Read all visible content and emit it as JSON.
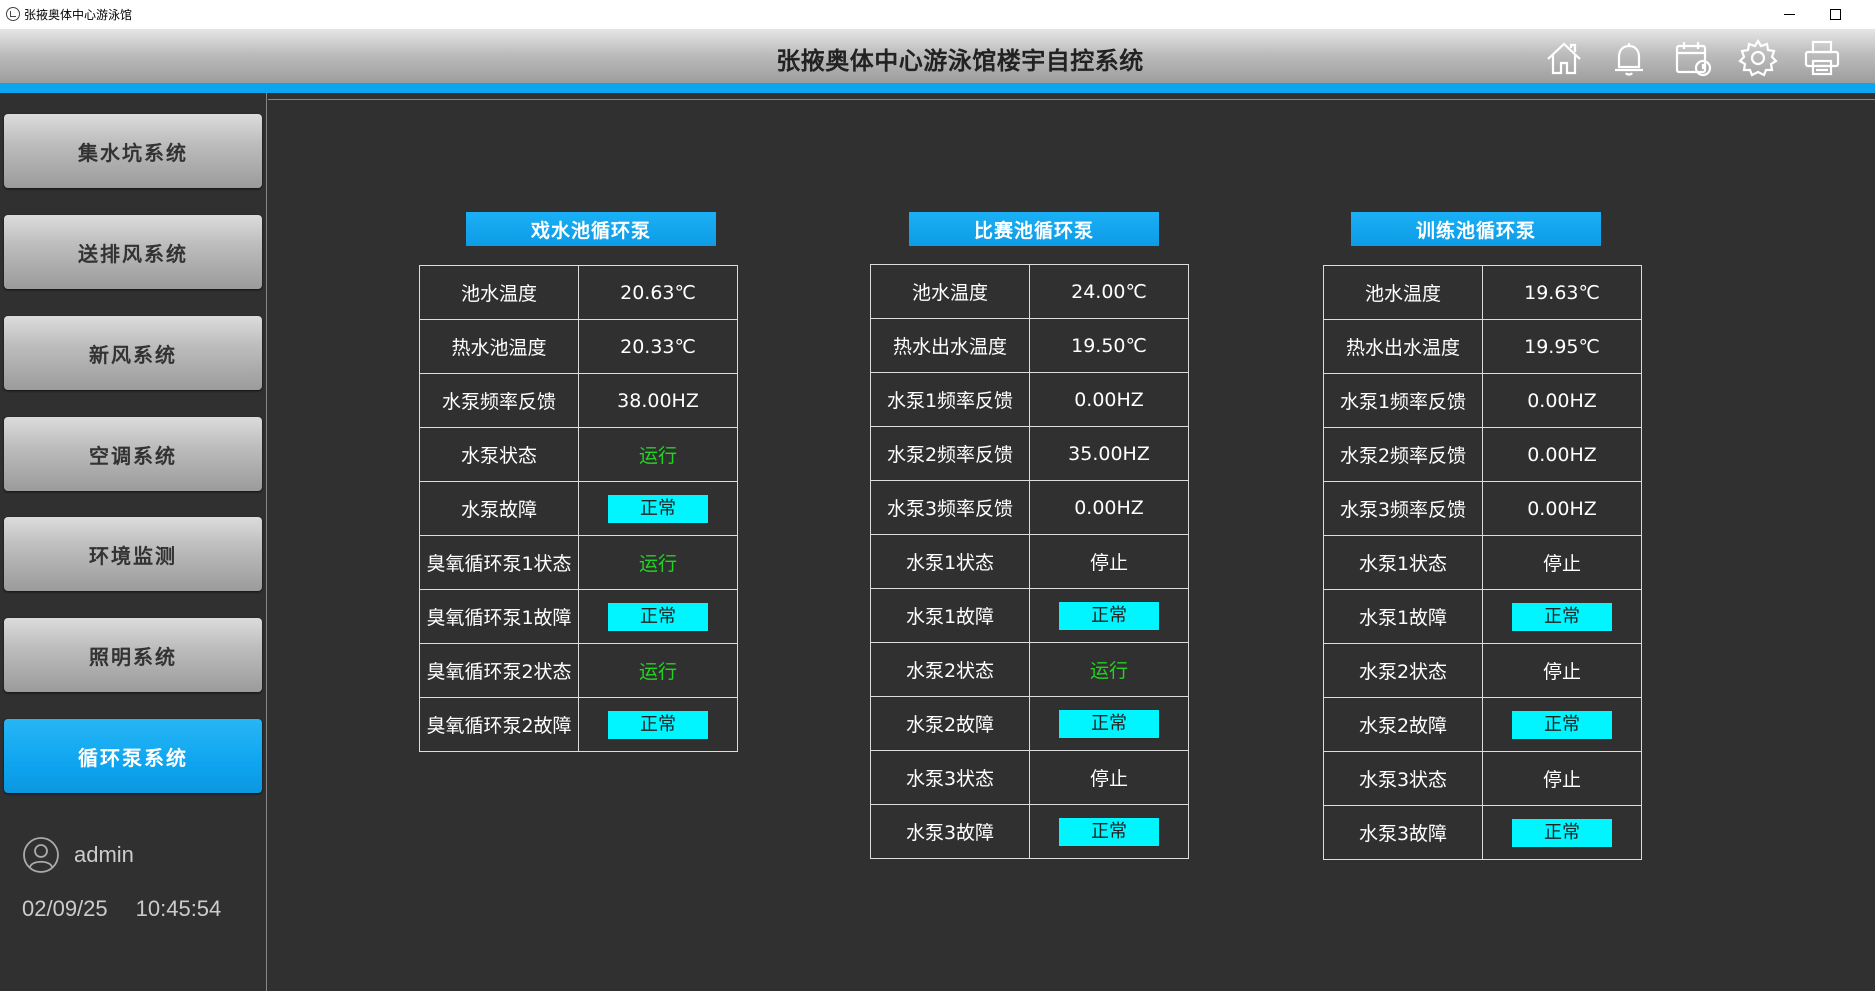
{
  "window": {
    "title": "张掖奥体中心游泳馆"
  },
  "header": {
    "title": "张掖奥体中心游泳馆楼宇自控系统",
    "icons": [
      "home-icon",
      "bell-icon",
      "calendar-icon",
      "gear-icon",
      "printer-icon"
    ]
  },
  "sidebar": {
    "items": [
      {
        "label": "集水坑系统",
        "active": false
      },
      {
        "label": "送排风系统",
        "active": false
      },
      {
        "label": "新风系统",
        "active": false
      },
      {
        "label": "空调系统",
        "active": false
      },
      {
        "label": "环境监测",
        "active": false
      },
      {
        "label": "照明系统",
        "active": false
      },
      {
        "label": "循环泵系统",
        "active": true
      }
    ],
    "user": "admin",
    "date": "02/09/25",
    "time": "10:45:54"
  },
  "colors": {
    "accent": "#0ea5f0",
    "ok_badge": "#00f5ff",
    "running": "#22d322"
  },
  "panels": [
    {
      "title": "戏水池循环泵",
      "rows": [
        {
          "label": "池水温度",
          "value": "20.63℃",
          "kind": "text"
        },
        {
          "label": "热水池温度",
          "value": "20.33℃",
          "kind": "text"
        },
        {
          "label": "水泵频率反馈",
          "value": "38.00HZ",
          "kind": "text"
        },
        {
          "label": "水泵状态",
          "value": "运行",
          "kind": "run"
        },
        {
          "label": "水泵故障",
          "value": "正常",
          "kind": "ok"
        },
        {
          "label": "臭氧循环泵1状态",
          "value": "运行",
          "kind": "run"
        },
        {
          "label": "臭氧循环泵1故障",
          "value": "正常",
          "kind": "ok"
        },
        {
          "label": "臭氧循环泵2状态",
          "value": "运行",
          "kind": "run"
        },
        {
          "label": "臭氧循环泵2故障",
          "value": "正常",
          "kind": "ok"
        }
      ]
    },
    {
      "title": "比赛池循环泵",
      "rows": [
        {
          "label": "池水温度",
          "value": "24.00℃",
          "kind": "text"
        },
        {
          "label": "热水出水温度",
          "value": "19.50℃",
          "kind": "text"
        },
        {
          "label": "水泵1频率反馈",
          "value": "0.00HZ",
          "kind": "text"
        },
        {
          "label": "水泵2频率反馈",
          "value": "35.00HZ",
          "kind": "text"
        },
        {
          "label": "水泵3频率反馈",
          "value": "0.00HZ",
          "kind": "text"
        },
        {
          "label": "水泵1状态",
          "value": "停止",
          "kind": "stop"
        },
        {
          "label": "水泵1故障",
          "value": "正常",
          "kind": "ok"
        },
        {
          "label": "水泵2状态",
          "value": "运行",
          "kind": "run"
        },
        {
          "label": "水泵2故障",
          "value": "正常",
          "kind": "ok"
        },
        {
          "label": "水泵3状态",
          "value": "停止",
          "kind": "stop"
        },
        {
          "label": "水泵3故障",
          "value": "正常",
          "kind": "ok"
        }
      ]
    },
    {
      "title": "训练池循环泵",
      "rows": [
        {
          "label": "池水温度",
          "value": "19.63℃",
          "kind": "text"
        },
        {
          "label": "热水出水温度",
          "value": "19.95℃",
          "kind": "text"
        },
        {
          "label": "水泵1频率反馈",
          "value": "0.00HZ",
          "kind": "text"
        },
        {
          "label": "水泵2频率反馈",
          "value": "0.00HZ",
          "kind": "text"
        },
        {
          "label": "水泵3频率反馈",
          "value": "0.00HZ",
          "kind": "text"
        },
        {
          "label": "水泵1状态",
          "value": "停止",
          "kind": "stop"
        },
        {
          "label": "水泵1故障",
          "value": "正常",
          "kind": "ok"
        },
        {
          "label": "水泵2状态",
          "value": "停止",
          "kind": "stop"
        },
        {
          "label": "水泵2故障",
          "value": "正常",
          "kind": "ok"
        },
        {
          "label": "水泵3状态",
          "value": "停止",
          "kind": "stop"
        },
        {
          "label": "水泵3故障",
          "value": "正常",
          "kind": "ok"
        }
      ]
    }
  ]
}
